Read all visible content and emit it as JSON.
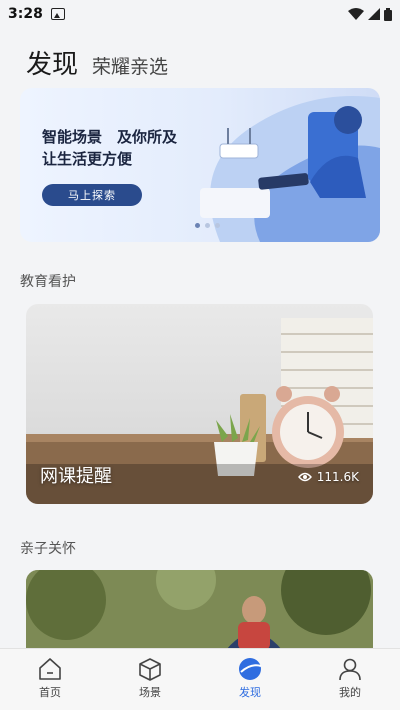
{
  "status_bar": {
    "time": "3:28"
  },
  "header": {
    "title": "发现",
    "subtitle": "荣耀亲选"
  },
  "banner": {
    "headline_line1": "智能场景　及你所及",
    "headline_line2": "让生活更方便",
    "button_label": "马上探索"
  },
  "sections": [
    {
      "label": "教育看护",
      "card_title": "网课提醒",
      "card_views": "111.6K"
    },
    {
      "label": "亲子关怀"
    }
  ],
  "nav": {
    "items": [
      {
        "label": "首页",
        "icon": "home-icon"
      },
      {
        "label": "场景",
        "icon": "cube-icon"
      },
      {
        "label": "发现",
        "icon": "discover-icon"
      },
      {
        "label": "我的",
        "icon": "person-icon"
      }
    ],
    "active_index": 2,
    "active_color": "#2f6de0"
  }
}
